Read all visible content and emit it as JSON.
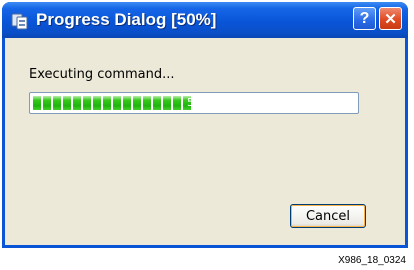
{
  "window": {
    "title": "Progress Dialog [50%]",
    "help_label": "?",
    "close_label": "✕"
  },
  "status_text": "Executing command...",
  "progress": {
    "percent": 50,
    "label": "50"
  },
  "buttons": {
    "cancel_label": "Cancel"
  },
  "caption": "X986_18_0324",
  "colors": {
    "titlebar": "#0955d8",
    "client_bg": "#ece9d8",
    "progress_fill": "#1fb40c",
    "close_button": "#e04a22",
    "help_button": "#2a6ae6"
  },
  "icons": {
    "app": "app-icon",
    "help": "help-icon",
    "close": "close-icon"
  }
}
